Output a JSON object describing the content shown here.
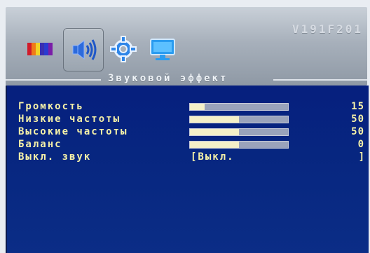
{
  "header": {
    "model": "V191F201",
    "icons": [
      {
        "name": "color-bars-icon",
        "active": false
      },
      {
        "name": "speaker-icon",
        "active": true
      },
      {
        "name": "gear-icon",
        "active": false
      },
      {
        "name": "monitor-icon",
        "active": false
      }
    ]
  },
  "section": {
    "title": "Звуковой эффект"
  },
  "settings": [
    {
      "label": "Громкость",
      "value": "15",
      "level": 0.15
    },
    {
      "label": "Низкие частоты",
      "value": "50",
      "level": 0.5
    },
    {
      "label": "Высокие частоты",
      "value": "50",
      "level": 0.5
    },
    {
      "label": "Баланс",
      "value": "0",
      "level": 0.5
    },
    {
      "label": "Выкл. звук",
      "option": "[Выкл.",
      "close": "]"
    }
  ],
  "colors": {
    "panel": "#072680",
    "text": "#f5f1a8",
    "bar_track": "#9aa3bb",
    "bar_fill": "#f4f0c8"
  }
}
